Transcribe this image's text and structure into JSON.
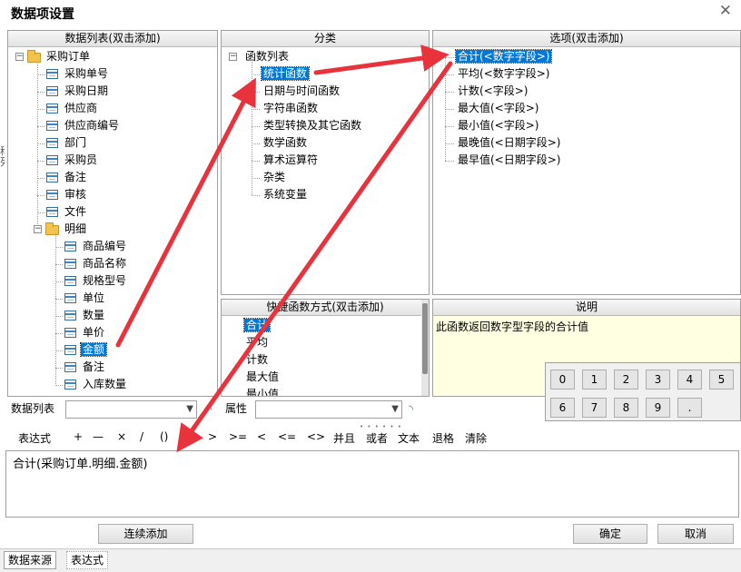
{
  "window": {
    "title": "数据项设置",
    "close_glyph": "✕"
  },
  "left_edge_chars": [
    "称",
    "列"
  ],
  "field_list": {
    "header": "数据列表(双击添加)",
    "root": "采购订单",
    "items": [
      "采购单号",
      "采购日期",
      "供应商",
      "供应商编号",
      "部门",
      "采购员",
      "备注",
      "审核",
      "文件"
    ],
    "detail_group": "明细",
    "detail_items": [
      "商品编号",
      "商品名称",
      "规格型号",
      "单位",
      "数量",
      "单价",
      "金额",
      "备注",
      "入库数量"
    ],
    "selected": "金额"
  },
  "category": {
    "header": "分类",
    "root": "函数列表",
    "items": [
      "统计函数",
      "日期与时间函数",
      "字符串函数",
      "类型转换及其它函数",
      "数学函数",
      "算术运算符",
      "杂类",
      "系统变量"
    ],
    "selected": "统计函数"
  },
  "options": {
    "header": "选项(双击添加)",
    "items": [
      "合计(<数字字段>)",
      "平均(<数字字段>)",
      "计数(<字段>)",
      "最大值(<字段>)",
      "最小值(<字段>)",
      "最晚值(<日期字段>)",
      "最早值(<日期字段>)"
    ],
    "selected": "合计(<数字字段>)"
  },
  "fast_functions": {
    "header": "快捷函数方式(双击添加)",
    "items": [
      "合计",
      "平均",
      "计数",
      "最大值",
      "最小值"
    ],
    "selected": "合计"
  },
  "description": {
    "header": "说明",
    "text": "此函数返回数字型字段的合计值"
  },
  "keypad": {
    "keys": [
      "0",
      "1",
      "2",
      "3",
      "4",
      "5",
      "6",
      "7",
      "8",
      "9",
      "."
    ]
  },
  "selectors": {
    "datalist_label": "数据列表",
    "property_label": "属性"
  },
  "operators": [
    "表达式",
    "+",
    "—",
    "×",
    "/",
    "()",
    ">",
    ">=",
    "<",
    "<=",
    "<>",
    "并且",
    "或者",
    "文本",
    "退格",
    "清除"
  ],
  "expression": {
    "value": "合计(采购订单.明细.金额)"
  },
  "buttons": {
    "continuous_add": "连续添加",
    "ok": "确定",
    "cancel": "取消"
  },
  "tabs": [
    "数据来源",
    "表达式"
  ],
  "colors": {
    "selection": "#0078d7",
    "arrow": "#e8323c",
    "description_bg": "#ffffe1"
  }
}
